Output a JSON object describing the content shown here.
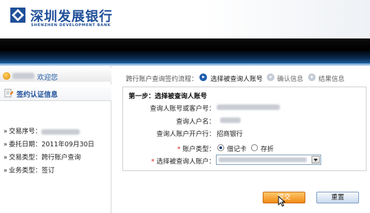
{
  "brand": {
    "name_cn": "深圳发展银行",
    "name_en": "SHENZHEN DEVELOPMENT BANK",
    "logo_icon": "sdb-logo-icon",
    "color": "#1f4f99"
  },
  "sidebar": {
    "welcome": "欢迎您",
    "section_title": "签约认证信息",
    "items": [
      {
        "label": "交易序号：",
        "value": ""
      },
      {
        "label": "委托日期：",
        "value": "2011年09月30日"
      },
      {
        "label": "交易类型：",
        "value": "跨行账户查询"
      },
      {
        "label": "业务类型：",
        "value": "签订"
      }
    ]
  },
  "flow": {
    "label": "跨行账户查询签约流程：",
    "steps": [
      {
        "label": "选择被查询人账号",
        "state": "active"
      },
      {
        "label": "确认信息",
        "state": "pending"
      },
      {
        "label": "结果信息",
        "state": "pending"
      }
    ]
  },
  "form": {
    "step_title": "第一步：选择被查询人账号",
    "account_label": "查询人账号或客户号：",
    "name_label": "查询人户名：",
    "bank_label": "查询人账户开户行：",
    "bank_value": "招商银行",
    "type_label": "账户类型：",
    "type_options": [
      "借记卡",
      "存折"
    ],
    "type_selected": "借记卡",
    "select_label": "选择被查询人账户："
  },
  "buttons": {
    "submit": "提交",
    "reset": "重置"
  },
  "colors": {
    "accent_orange": "#f08a14",
    "link_blue": "#1a5aa8",
    "required_red": "#d22222"
  }
}
